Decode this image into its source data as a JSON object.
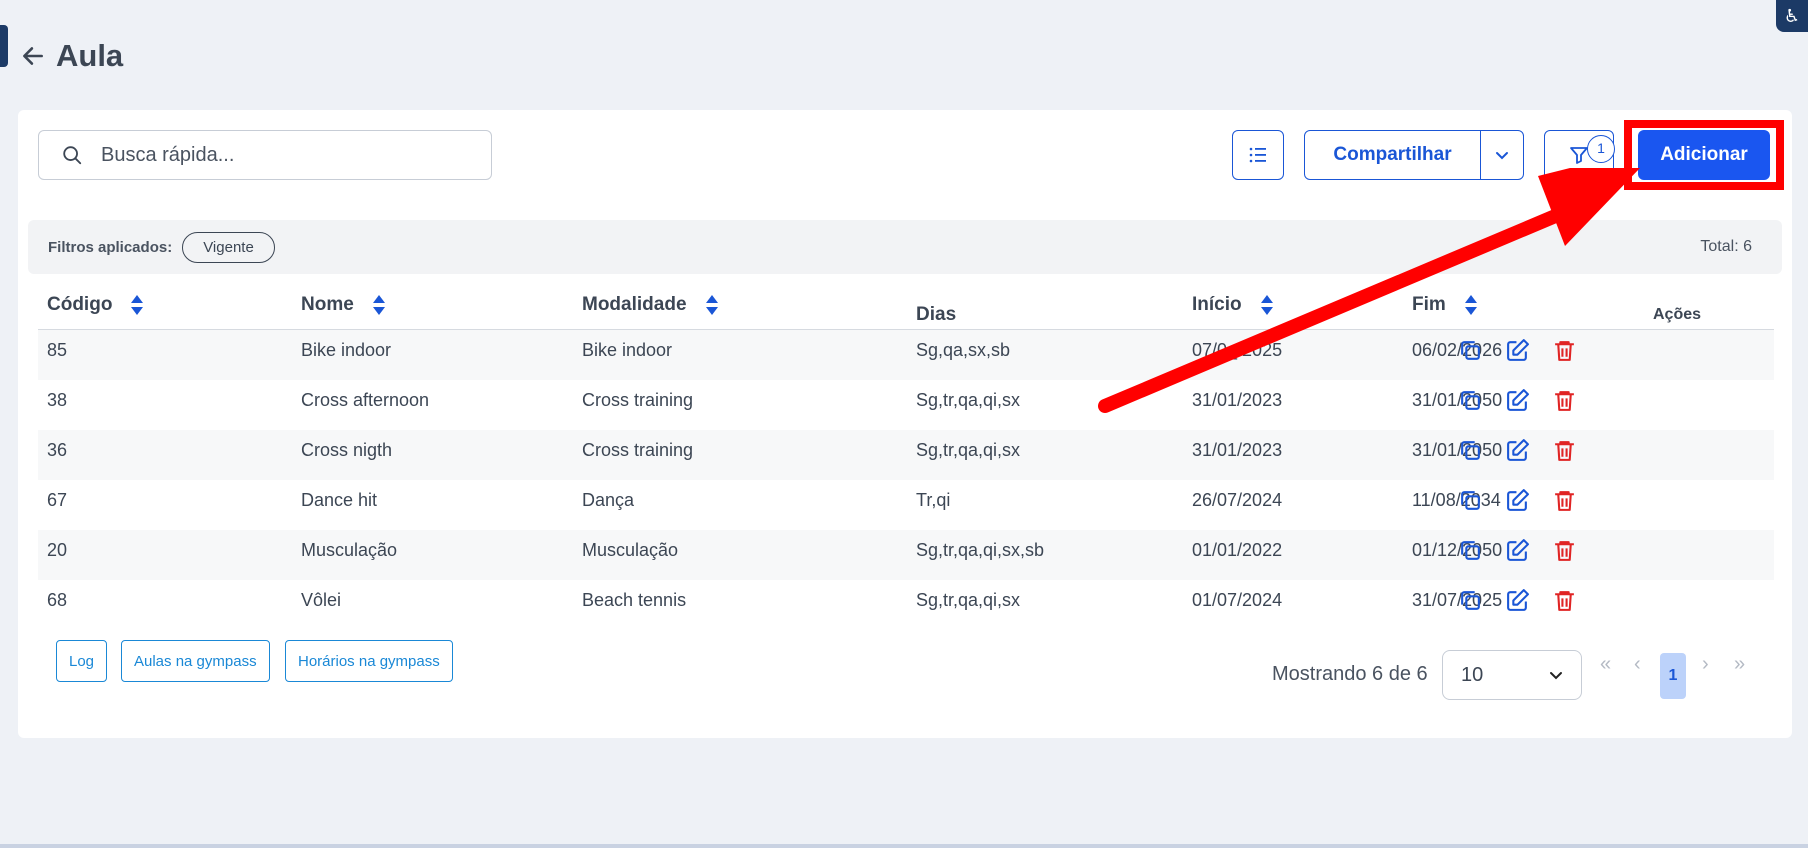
{
  "header": {
    "title": "Aula",
    "corner_icon": "accessibility-icon"
  },
  "toolbar": {
    "search_placeholder": "Busca rápida...",
    "share_label": "Compartilhar",
    "filter_count": "1",
    "add_label": "Adicionar"
  },
  "filters": {
    "label": "Filtros aplicados:",
    "chips": [
      "Vigente"
    ],
    "total": "Total: 6"
  },
  "table": {
    "columns": [
      "Código",
      "Nome",
      "Modalidade",
      "Dias",
      "Início",
      "Fim",
      "Ações"
    ],
    "rows": [
      {
        "codigo": "85",
        "nome": "Bike indoor",
        "modalidade": "Bike indoor",
        "dias": "Sg,qa,sx,sb",
        "inicio": "07/0_/2025",
        "fim": "06/02/2026"
      },
      {
        "codigo": "38",
        "nome": "Cross afternoon",
        "modalidade": "Cross training",
        "dias": "Sg,tr,qa,qi,sx",
        "inicio": "31/01/2023",
        "fim": "31/01/2050"
      },
      {
        "codigo": "36",
        "nome": "Cross nigth",
        "modalidade": "Cross training",
        "dias": "Sg,tr,qa,qi,sx",
        "inicio": "31/01/2023",
        "fim": "31/01/2050"
      },
      {
        "codigo": "67",
        "nome": "Dance hit",
        "modalidade": "Dança",
        "dias": "Tr,qi",
        "inicio": "26/07/2024",
        "fim": "11/08/2034"
      },
      {
        "codigo": "20",
        "nome": "Musculação",
        "modalidade": "Musculação",
        "dias": "Sg,tr,qa,qi,sx,sb",
        "inicio": "01/01/2022",
        "fim": "01/12/2050"
      },
      {
        "codigo": "68",
        "nome": "Vôlei",
        "modalidade": "Beach tennis",
        "dias": "Sg,tr,qa,qi,sx",
        "inicio": "01/07/2024",
        "fim": "31/07/2025"
      }
    ]
  },
  "footer": {
    "buttons": [
      "Log",
      "Aulas na gympass",
      "Horários na gympass"
    ],
    "showing": "Mostrando 6 de 6",
    "page_size": "10",
    "current_page": "1"
  },
  "colors": {
    "primary": "#1a56f0",
    "annotation": "#ff0000",
    "delete": "#e02424"
  }
}
